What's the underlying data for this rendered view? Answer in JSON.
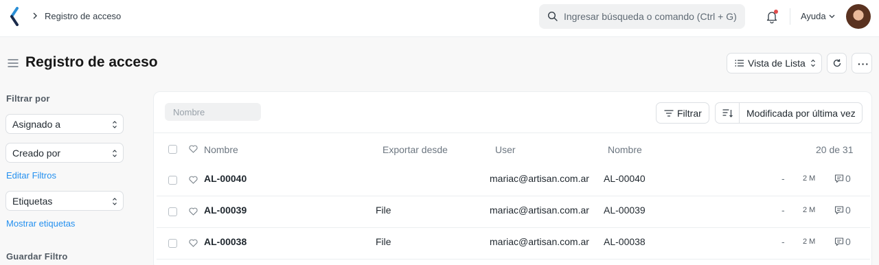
{
  "navbar": {
    "breadcrumb": "Registro de acceso",
    "search_placeholder": "Ingresar búsqueda o comando (Ctrl + G)",
    "help_label": "Ayuda"
  },
  "page": {
    "title": "Registro de acceso",
    "view_button": "Vista de Lista"
  },
  "sidebar": {
    "filter_heading": "Filtrar por",
    "assigned_to": "Asignado a",
    "created_by": "Creado por",
    "edit_filters": "Editar Filtros",
    "tags": "Etiquetas",
    "show_tags": "Mostrar etiquetas",
    "save_filter": "Guardar Filtro"
  },
  "list": {
    "name_filter_placeholder": "Nombre",
    "filter_button": "Filtrar",
    "sort_button": "Modificada por última vez",
    "columns": [
      "Nombre",
      "Exportar desde",
      "User",
      "Nombre"
    ],
    "count": "20 de 31",
    "rows": [
      {
        "id": "AL-00040",
        "export_from": "",
        "user": "mariac@artisan.com.ar",
        "name": "AL-00040",
        "dash": "-",
        "modified": "2 M",
        "comments": "0"
      },
      {
        "id": "AL-00039",
        "export_from": "File",
        "user": "mariac@artisan.com.ar",
        "name": "AL-00039",
        "dash": "-",
        "modified": "2 M",
        "comments": "0"
      },
      {
        "id": "AL-00038",
        "export_from": "File",
        "user": "mariac@artisan.com.ar",
        "name": "AL-00038",
        "dash": "-",
        "modified": "2 M",
        "comments": "0"
      }
    ]
  },
  "icons": {
    "logo": "app-logo-icon",
    "breadcrumb_separator": "chevron-right-icon",
    "search": "search-icon",
    "notifications": "bell-icon",
    "help_dropdown": "chevron-down-icon",
    "menu": "hamburger-icon",
    "list_view": "list-icon",
    "refresh": "refresh-icon",
    "more": "more-horizontal-icon",
    "filter": "filter-icon",
    "sort": "sort-icon",
    "like": "heart-icon",
    "comments": "comment-icon"
  },
  "colors": {
    "link": "#2490ef",
    "notification_dot": "#e24c4c",
    "logo_dark": "#1a2a4a",
    "logo_accent": "#2b8fd6"
  }
}
